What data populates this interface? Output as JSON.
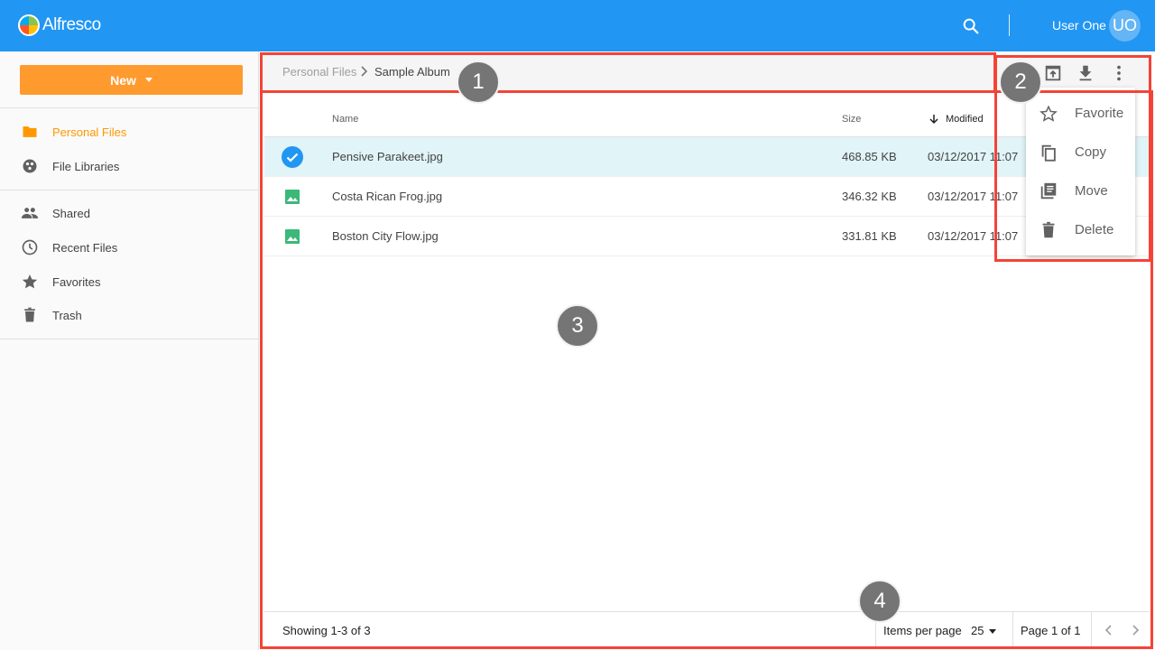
{
  "header": {
    "logo_text": "Alfresco",
    "user_name": "User One",
    "user_initials": "UO",
    "brand_color": "#2196f3"
  },
  "sidebar": {
    "new_button_label": "New",
    "accent_color": "#ff9a2e",
    "items": [
      {
        "label": "Personal Files",
        "icon": "folder-icon",
        "active": true
      },
      {
        "label": "File Libraries",
        "icon": "libraries-icon",
        "active": false
      },
      {
        "label": "Shared",
        "icon": "people-icon",
        "active": false
      },
      {
        "label": "Recent Files",
        "icon": "clock-icon",
        "active": false
      },
      {
        "label": "Favorites",
        "icon": "star-icon",
        "active": false
      },
      {
        "label": "Trash",
        "icon": "trash-icon",
        "active": false
      }
    ]
  },
  "breadcrumb": {
    "parent": "Personal Files",
    "current": "Sample Album"
  },
  "toolbar": {
    "icons": [
      "open-in-new-icon",
      "download-icon",
      "more-vert-icon"
    ]
  },
  "table": {
    "columns": {
      "name": "Name",
      "size": "Size",
      "modified": "Modified"
    },
    "rows": [
      {
        "name": "Pensive Parakeet.jpg",
        "size": "468.85 KB",
        "modified": "03/12/2017 11:07",
        "selected": true
      },
      {
        "name": "Costa Rican Frog.jpg",
        "size": "346.32 KB",
        "modified": "03/12/2017 11:07",
        "selected": false
      },
      {
        "name": "Boston City Flow.jpg",
        "size": "331.81 KB",
        "modified": "03/12/2017 11:07",
        "selected": false
      }
    ]
  },
  "context_menu": {
    "items": [
      {
        "label": "Favorite",
        "icon": "star-outline-icon"
      },
      {
        "label": "Copy",
        "icon": "copy-icon"
      },
      {
        "label": "Move",
        "icon": "move-icon"
      },
      {
        "label": "Delete",
        "icon": "delete-icon"
      }
    ]
  },
  "pagination": {
    "showing": "Showing 1-3 of 3",
    "items_per_page_label": "Items per page",
    "items_per_page_value": "25",
    "page_label": "Page 1 of 1"
  },
  "annotations": {
    "badges": [
      "1",
      "2",
      "3",
      "4"
    ],
    "highlight_color": "#f44336"
  }
}
